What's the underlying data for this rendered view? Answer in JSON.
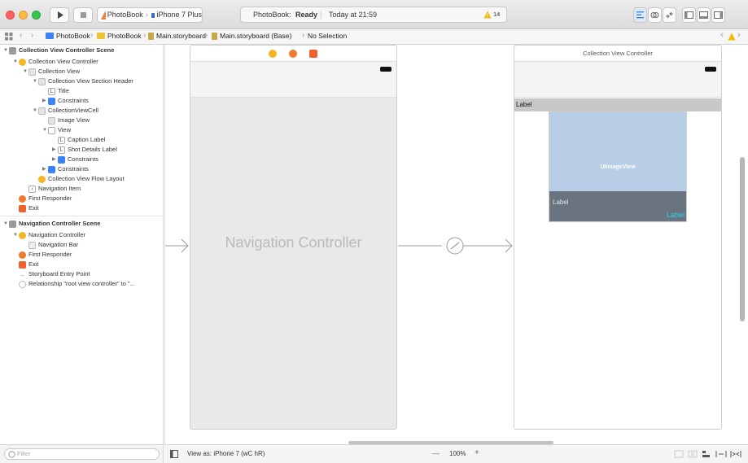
{
  "toolbar": {
    "scheme_app": "PhotoBook",
    "scheme_device": "iPhone 7 Plus",
    "activity_app": "PhotoBook:",
    "activity_status": "Ready",
    "activity_time": "Today at 21:59",
    "warning_count": "14"
  },
  "jumpbar": {
    "items": [
      "PhotoBook",
      "PhotoBook",
      "Main.storyboard",
      "Main.storyboard (Base)",
      "No Selection"
    ]
  },
  "outline": {
    "scene1_title": "Collection View Controller Scene",
    "items": [
      "Collection View Controller",
      "Collection View",
      "Collection View Section Header",
      "Title",
      "Constraints",
      "CollectionViewCell",
      "Image View",
      "View",
      "Caption Label",
      "Shot Details Label",
      "Constraints",
      "Constraints",
      "Collection View Flow Layout",
      "Navigation Item",
      "First Responder",
      "Exit"
    ],
    "scene2_title": "Navigation Controller Scene",
    "items2": [
      "Navigation Controller",
      "Navigation Bar",
      "First Responder",
      "Exit",
      "Storyboard Entry Point",
      "Relationship \"root view controller\" to \"..."
    ],
    "filter_placeholder": "Filter"
  },
  "canvas": {
    "nav_controller_label": "Navigation Controller",
    "cvc_title": "Collection View Controller",
    "header_label": "Label",
    "image_view_label": "UIImageView",
    "caption_label": "Label",
    "details_label": "Label"
  },
  "bottombar": {
    "view_as": "View as: iPhone 7 (wC hR)",
    "zoom": "100%",
    "zoom_minus": "—",
    "zoom_plus": "+"
  },
  "colors": {
    "accent_blue": "#3b82f6",
    "warning_yellow": "#f2b600",
    "image_view_blue": "#b8cde6",
    "overlay_gray": "#6a7380",
    "label_cyan": "#2ad4e8"
  }
}
